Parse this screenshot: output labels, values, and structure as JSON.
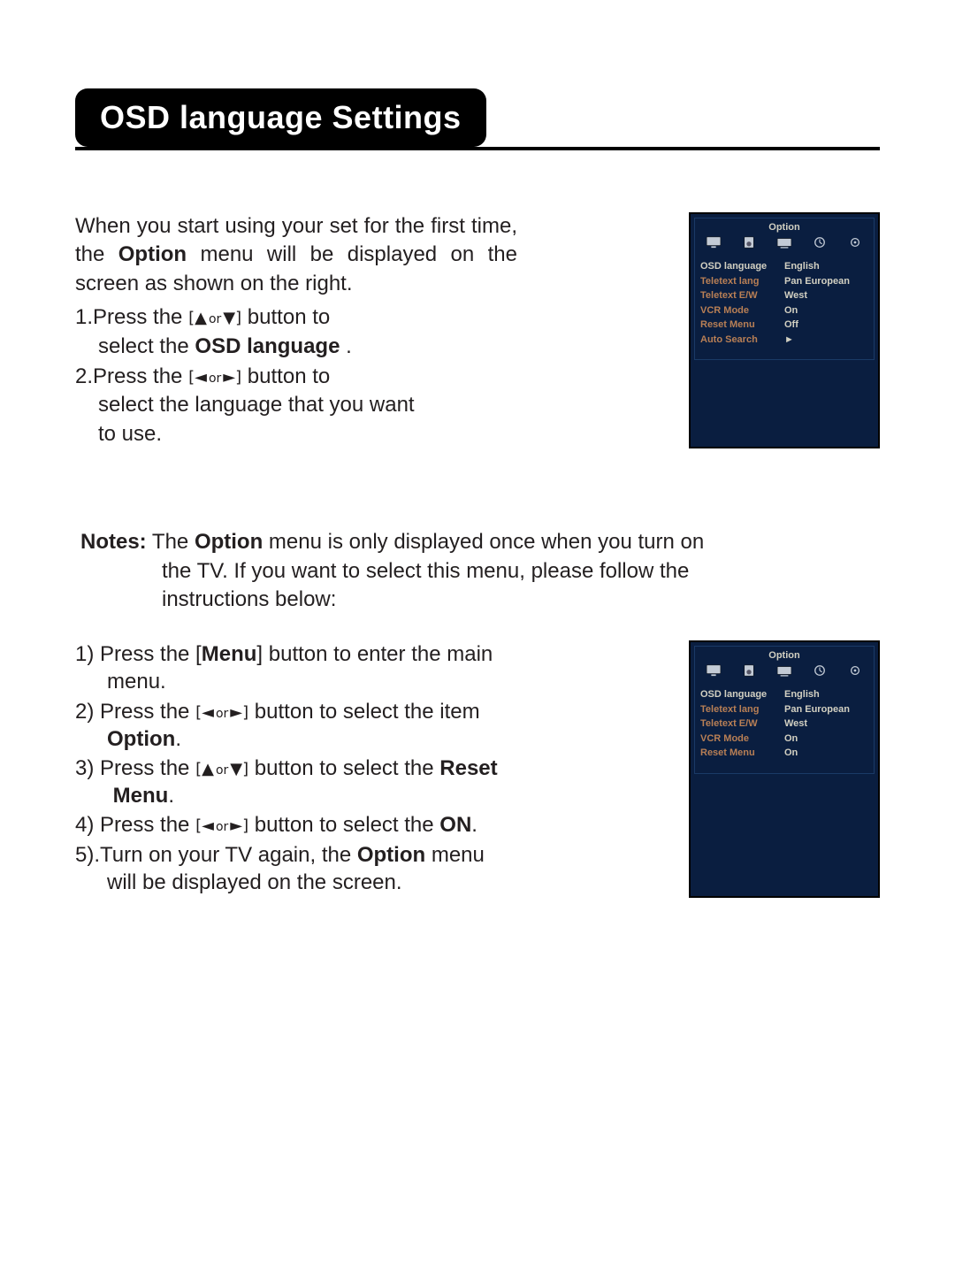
{
  "title": "OSD language Settings",
  "intro": "When you start using your set for the first time, the Option menu will be displayed on the screen as shown on the right.",
  "option_word": "Option",
  "step1_pre": "1.Press the ",
  "step1_post": " button to",
  "step1_line2a": "select the ",
  "step1_bold": "OSD language ",
  "step1_line2b": ".",
  "step2_pre": "2.Press the  ",
  "step2_post": "    button to",
  "step2_line2": "select the language that you want",
  "step2_line3": "to use.",
  "arrows_ud_l": "[",
  "arrows_ud_r": "]",
  "arrow_up": "▲",
  "arrow_down": "▼",
  "arrow_left": "◄",
  "arrow_right": "►",
  "arrow_sep": "or",
  "notes_label": "Notes:",
  "notes_line1a": " The ",
  "notes_line1b": "  menu is only  displayed once when you turn on",
  "notes_line2": "the TV. If you want to select this menu, please follow the",
  "notes_line3": "instructions below:",
  "s1_pre": "1) Press the [",
  "s1_bold": "Menu",
  "s1_post": "] button to enter the main",
  "s1_line2": "menu.",
  "s2_pre": "2) Press the  ",
  "s2_post": " button to select the item",
  "s2_bold": "Option",
  "s2_line2b": ".",
  "s3_pre": "3) Press the ",
  "s3_post": "  button to select the ",
  "s3_bold": "Reset",
  "s3_line2_bold": "Menu",
  "s3_line2b": ".",
  "s4_pre": "4) Press the ",
  "s4_post": " button to select the ",
  "s4_bold": "ON",
  "s4_end": ".",
  "s5_pre": "5).Turn on your TV again, the ",
  "s5_bold": "Option",
  "s5_post": "  menu",
  "s5_line2": "will be displayed on the screen.",
  "osd1": {
    "title": "Option",
    "rows": [
      {
        "label": "OSD language",
        "value": "English",
        "highlight": true
      },
      {
        "label": "Teletext lang",
        "value": "Pan European"
      },
      {
        "label": "Teletext E/W",
        "value": "West"
      },
      {
        "label": "VCR Mode",
        "value": "On"
      },
      {
        "label": "Reset Menu",
        "value": "Off"
      },
      {
        "label": "Auto Search",
        "value": "►"
      }
    ]
  },
  "osd2": {
    "title": "Option",
    "rows": [
      {
        "label": "OSD language",
        "value": "English",
        "highlight": true
      },
      {
        "label": "Teletext lang",
        "value": "Pan European"
      },
      {
        "label": "Teletext E/W",
        "value": "West"
      },
      {
        "label": "VCR Mode",
        "value": "On"
      },
      {
        "label": "Reset Menu",
        "value": "On"
      }
    ]
  }
}
